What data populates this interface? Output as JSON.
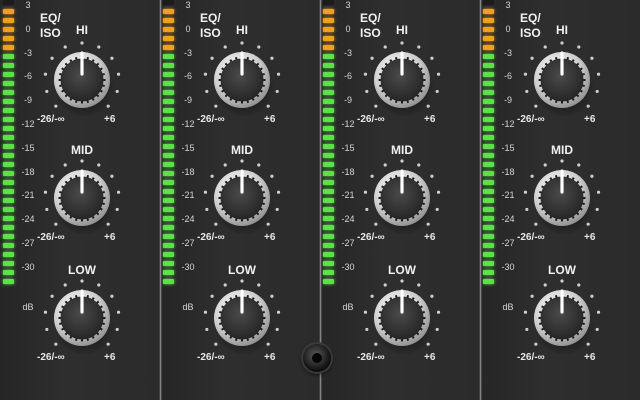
{
  "colors": {
    "meter_green": "#5de04a",
    "meter_orange": "#f0a020",
    "meter_off": "#1b1b1b",
    "knob_cap": "#3a3a3a",
    "knob_ring": "#dcdcdc"
  },
  "meter_scale": [
    "3",
    "0",
    "-3",
    "-6",
    "-9",
    "-12",
    "-15",
    "-18",
    "-21",
    "-24",
    "-27",
    "-30"
  ],
  "meter_unit": "dB",
  "eq_label_line1": "EQ/",
  "eq_label_line2": "ISO",
  "bands": [
    {
      "id": "hi",
      "label": "HI",
      "min_label": "-26/-∞",
      "max_label": "+6"
    },
    {
      "id": "mid",
      "label": "MID",
      "min_label": "-26/-∞",
      "max_label": "+6"
    },
    {
      "id": "low",
      "label": "LOW",
      "min_label": "-26/-∞",
      "max_label": "+6"
    }
  ],
  "channels": [
    {
      "channel": 1,
      "meter_level": 0.8,
      "knob_values": [
        0.5,
        0.5,
        0.5
      ]
    },
    {
      "channel": 2,
      "meter_level": 0.8,
      "knob_values": [
        0.5,
        0.5,
        0.5
      ]
    },
    {
      "channel": 3,
      "meter_level": 0.8,
      "knob_values": [
        0.5,
        0.5,
        0.5
      ]
    },
    {
      "channel": 4,
      "meter_level": 0.8,
      "knob_values": [
        0.5,
        0.5,
        0.5
      ]
    }
  ]
}
